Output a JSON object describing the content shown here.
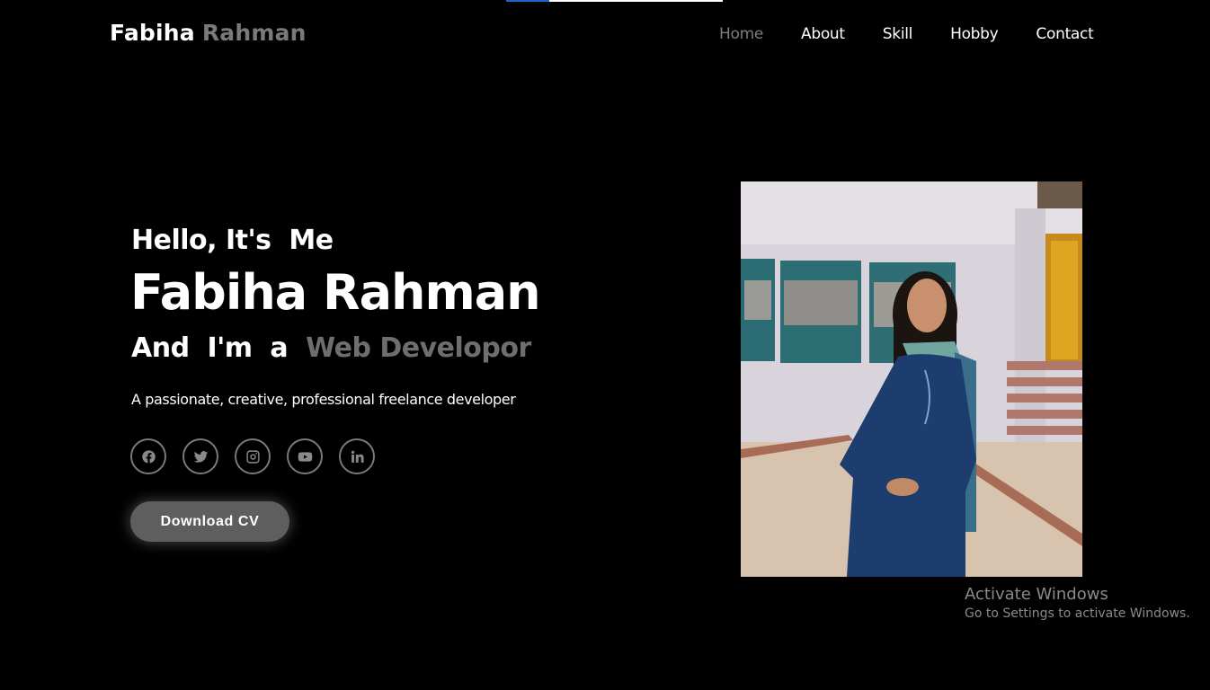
{
  "header": {
    "logo_first": "Fabiha",
    "logo_last": "Rahman",
    "nav": [
      {
        "label": "Home",
        "active": true
      },
      {
        "label": "About",
        "active": false
      },
      {
        "label": "Skill",
        "active": false
      },
      {
        "label": "Hobby",
        "active": false
      },
      {
        "label": "Contact",
        "active": false
      }
    ]
  },
  "page_load_progress": 0.2,
  "hero": {
    "greeting": "Hello, It's  Me",
    "name": "Fabiha Rahman",
    "role_prefix": "And  I'm  a  ",
    "role_title": "Web Developor",
    "tagline": "A passionate, creative, professional freelance developer",
    "socials": [
      {
        "icon": "facebook-icon"
      },
      {
        "icon": "twitter-icon"
      },
      {
        "icon": "instagram-icon"
      },
      {
        "icon": "youtube-icon"
      },
      {
        "icon": "linkedin-icon"
      }
    ],
    "cta_label": "Download CV"
  },
  "watermark": {
    "title": "Activate Windows",
    "subtitle": "Go to Settings to activate Windows."
  },
  "colors": {
    "background": "#000000",
    "accent_gray": "#6e6e6e",
    "button_bg": "#5e5e5e",
    "progress_blue": "#1e63c8"
  }
}
